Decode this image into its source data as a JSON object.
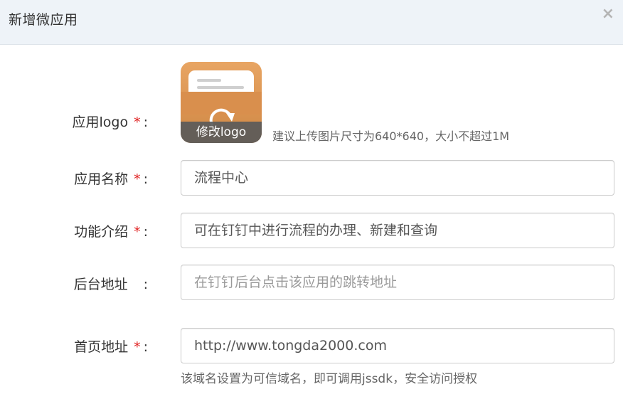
{
  "dialog": {
    "title": "新增微应用",
    "close_glyph": "×"
  },
  "form": {
    "logo": {
      "label": "应用logo",
      "required": "*",
      "colon": ":",
      "button_label": "修改logo",
      "hint": "建议上传图片尺寸为640*640，大小不超过1M",
      "icon": "inbox-tray-icon"
    },
    "name": {
      "label": "应用名称",
      "required": "*",
      "colon": ":",
      "value": "流程中心"
    },
    "description": {
      "label": "功能介绍",
      "required": "*",
      "colon": ":",
      "value": "可在钉钉中进行流程的办理、新建和查询"
    },
    "backend_url": {
      "label": "后台地址",
      "colon": ":",
      "placeholder": "在钉钉后台点击该应用的跳转地址"
    },
    "home_url": {
      "label": "首页地址",
      "required": "*",
      "colon": ":",
      "value": "http://www.tongda2000.com",
      "help": "该域名设置为可信域名，即可调用jssdk，安全访问授权"
    }
  },
  "colors": {
    "required": "#e02020",
    "header_bg": "#eef3f8",
    "logo_orange": "#e8a563"
  }
}
